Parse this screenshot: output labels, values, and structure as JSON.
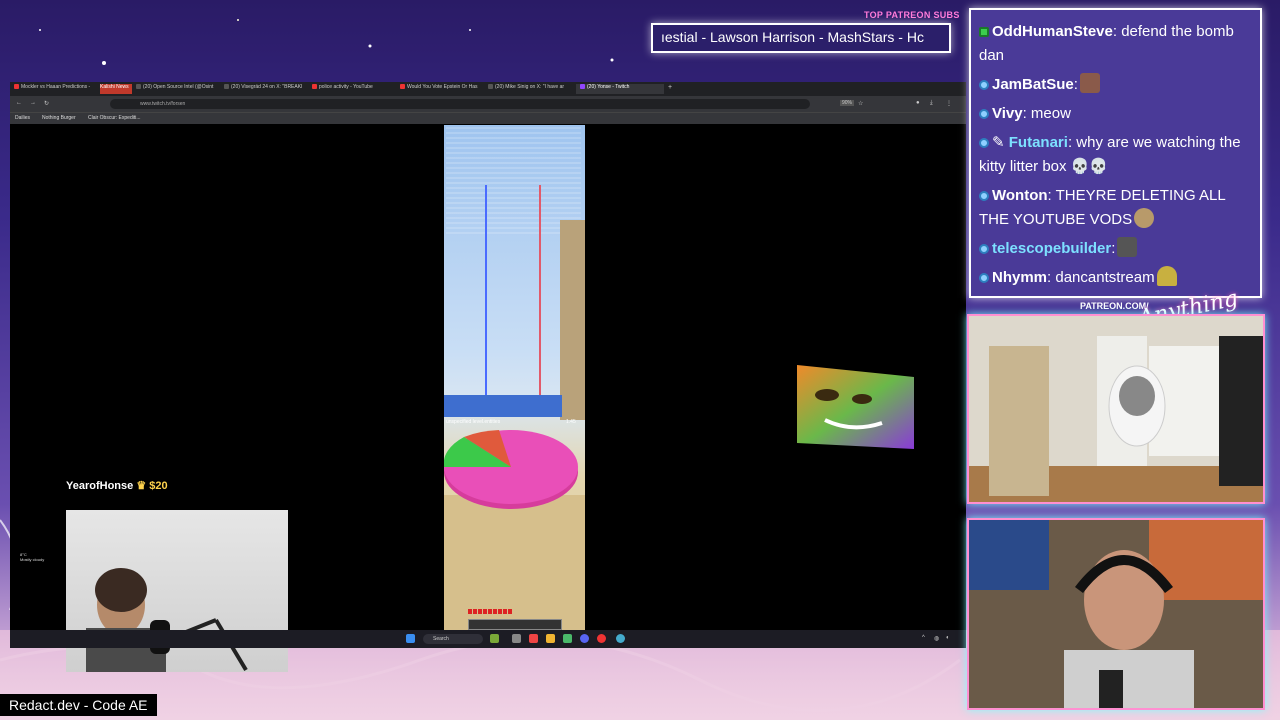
{
  "overlay": {
    "patreon_label": "TOP PATREON SUBS",
    "ticker_text": "ıestial - Lawson Harrison - MashStars - Hc",
    "patreon_url": "PATREON.COM/",
    "signature": "Anything Else",
    "watermark": "Redact.dev - Code AE"
  },
  "browser": {
    "tabs": [
      {
        "label": "Mockler vs Haaan Predictions -",
        "color": "#e25a2a"
      },
      {
        "label": "Kalishi News",
        "color": "#e33"
      },
      {
        "label": "(20) Open Source Intel (@Osint",
        "color": "#444"
      },
      {
        "label": "(20) Visegrád 24 on X: \"BREAKI",
        "color": "#444"
      },
      {
        "label": "police activity - YouTube",
        "color": "#e33"
      },
      {
        "label": "Would You Vote Epstein Or Has",
        "color": "#e33"
      },
      {
        "label": "(20) Mike Sinig on X: \"I have ar",
        "color": "#444"
      },
      {
        "label": "(20) Yonse - Twitch",
        "color": "#9146ff"
      }
    ],
    "new_tab": "+",
    "url": "www.twitch.tv/forsen",
    "zoom": "90%",
    "bookmarks": [
      "Dailies",
      "Nothing Burger",
      "Clair Obscur: Expediti..."
    ]
  },
  "stream": {
    "pie_label": "unspecified level.entities",
    "pie_value_label": "1.45"
  },
  "donation": {
    "name": "YearofHonse",
    "amount": "$20"
  },
  "taskbar": {
    "search_placeholder": "Search",
    "weather_temp": "8°C",
    "weather_desc": "Mostly cloudy"
  },
  "chat": {
    "messages": [
      {
        "user": "OddHumanSteve",
        "text": " defend the bomb dan",
        "badge": "green",
        "user_color": "#ffffff"
      },
      {
        "user": "JamBatSue",
        "text": "",
        "badge": "blue",
        "user_color": "#ffffff",
        "emote": "image-emote"
      },
      {
        "user": "Vivy",
        "text": " meow",
        "badge": "blue",
        "user_color": "#ffffff"
      },
      {
        "user": "Futanari",
        "text": " why are we watching the kitty litter box 💀💀",
        "badge": "blue",
        "user_color": "#7de0ff"
      },
      {
        "user": "Wonton",
        "text": " THEYRE DELETING ALL THE YOUTUBE VODS",
        "badge": "blue",
        "user_color": "#ffffff",
        "emote": "cat-emote"
      },
      {
        "user": "telescopebuilder",
        "text": "",
        "badge": "blue",
        "user_color": "#7de0ff",
        "emote": "rock-emote"
      },
      {
        "user": "Nhymm",
        "text": " dancantstream",
        "badge": "blue",
        "user_color": "#ffffff",
        "emote": "hat-emote"
      }
    ]
  }
}
